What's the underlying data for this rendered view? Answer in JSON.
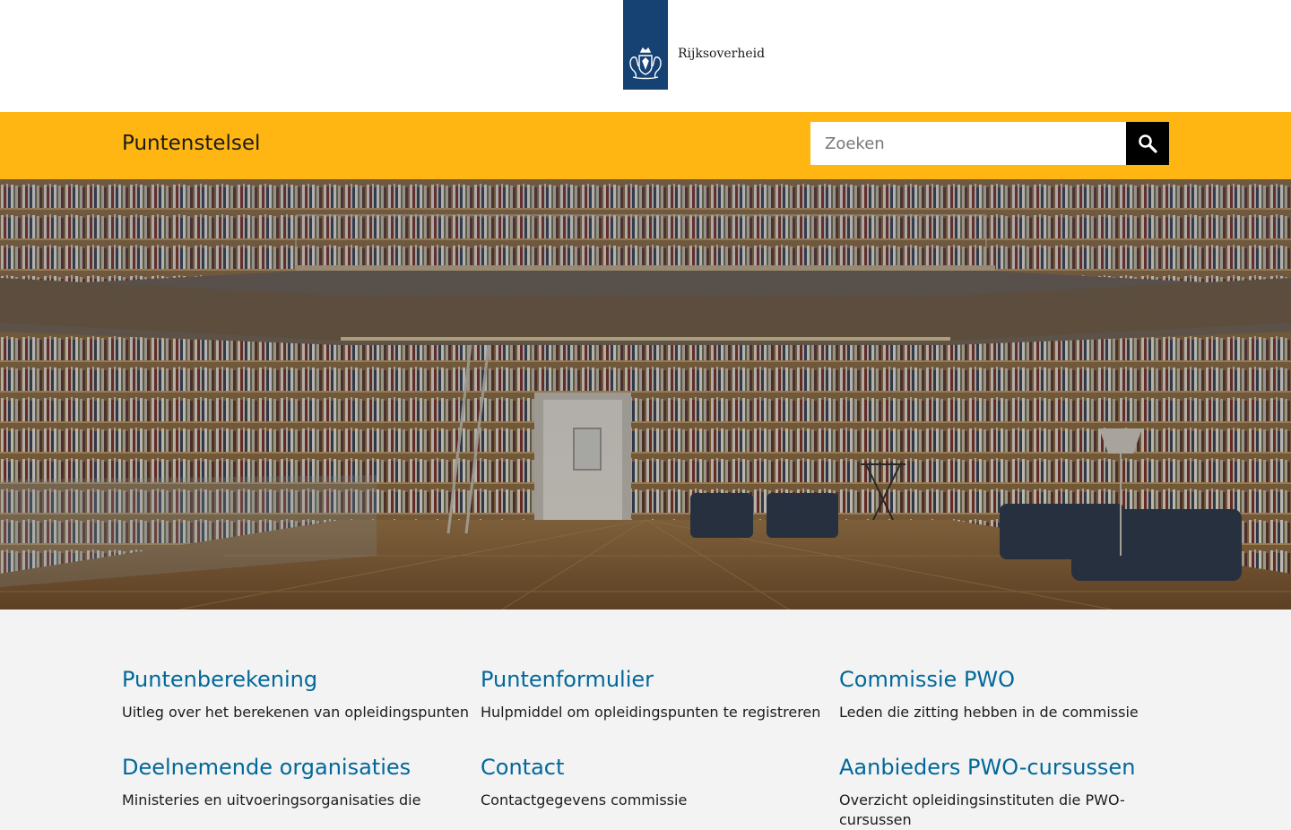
{
  "logo": {
    "text": "Rijksoverheid",
    "emblem_color": "#154273"
  },
  "header": {
    "site_title": "Puntenstelsel",
    "background": "#ffb612",
    "search": {
      "placeholder": "Zoeken",
      "value": "",
      "button_icon": "search-icon"
    }
  },
  "hero": {
    "description": "library-interior-photo"
  },
  "cards": [
    {
      "title": "Puntenberekening",
      "description": "Uitleg over het berekenen van opleidingspunten"
    },
    {
      "title": "Puntenformulier",
      "description": "Hulpmiddel om opleidingspunten te registreren"
    },
    {
      "title": "Commissie PWO",
      "description": "Leden die zitting hebben in de commissie"
    },
    {
      "title": "Deelnemende organisaties",
      "description": "Ministeries en uitvoeringsorganisaties die"
    },
    {
      "title": "Contact",
      "description": "Contactgegevens commissie"
    },
    {
      "title": "Aanbieders PWO-cursussen",
      "description": "Overzicht opleidingsinstituten die PWO-cursussen"
    }
  ],
  "colors": {
    "link": "#01689b",
    "page_bg": "#f3f3f3"
  }
}
